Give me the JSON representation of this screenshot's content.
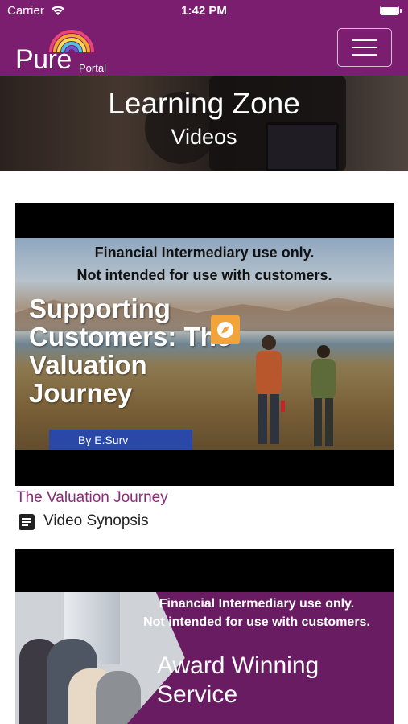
{
  "status_bar": {
    "carrier": "Carrier",
    "time": "1:42 PM"
  },
  "navbar": {
    "logo_main": "Pure",
    "logo_sub": "Portal",
    "menu_icon": "hamburger-icon"
  },
  "hero": {
    "title": "Learning Zone",
    "subtitle": "Videos"
  },
  "videos": [
    {
      "thumb_line1": "Financial Intermediary use only.",
      "thumb_line2": "Not intended for use with customers.",
      "thumb_headline": "Supporting Customers: The Valuation Journey",
      "thumb_byline": "By E.Surv",
      "title": "The Valuation Journey",
      "synopsis_label": "Video Synopsis",
      "synopsis_icon": "document-icon"
    },
    {
      "thumb_line1": "Financial Intermediary use only.",
      "thumb_line2": "Not intended for use with customers.",
      "thumb_headline": "Award Winning Service"
    }
  ],
  "colors": {
    "brand": "#7b1e6f",
    "link": "#8a2a7a",
    "byline": "#2a48a8",
    "accent": "#f2a33a"
  }
}
